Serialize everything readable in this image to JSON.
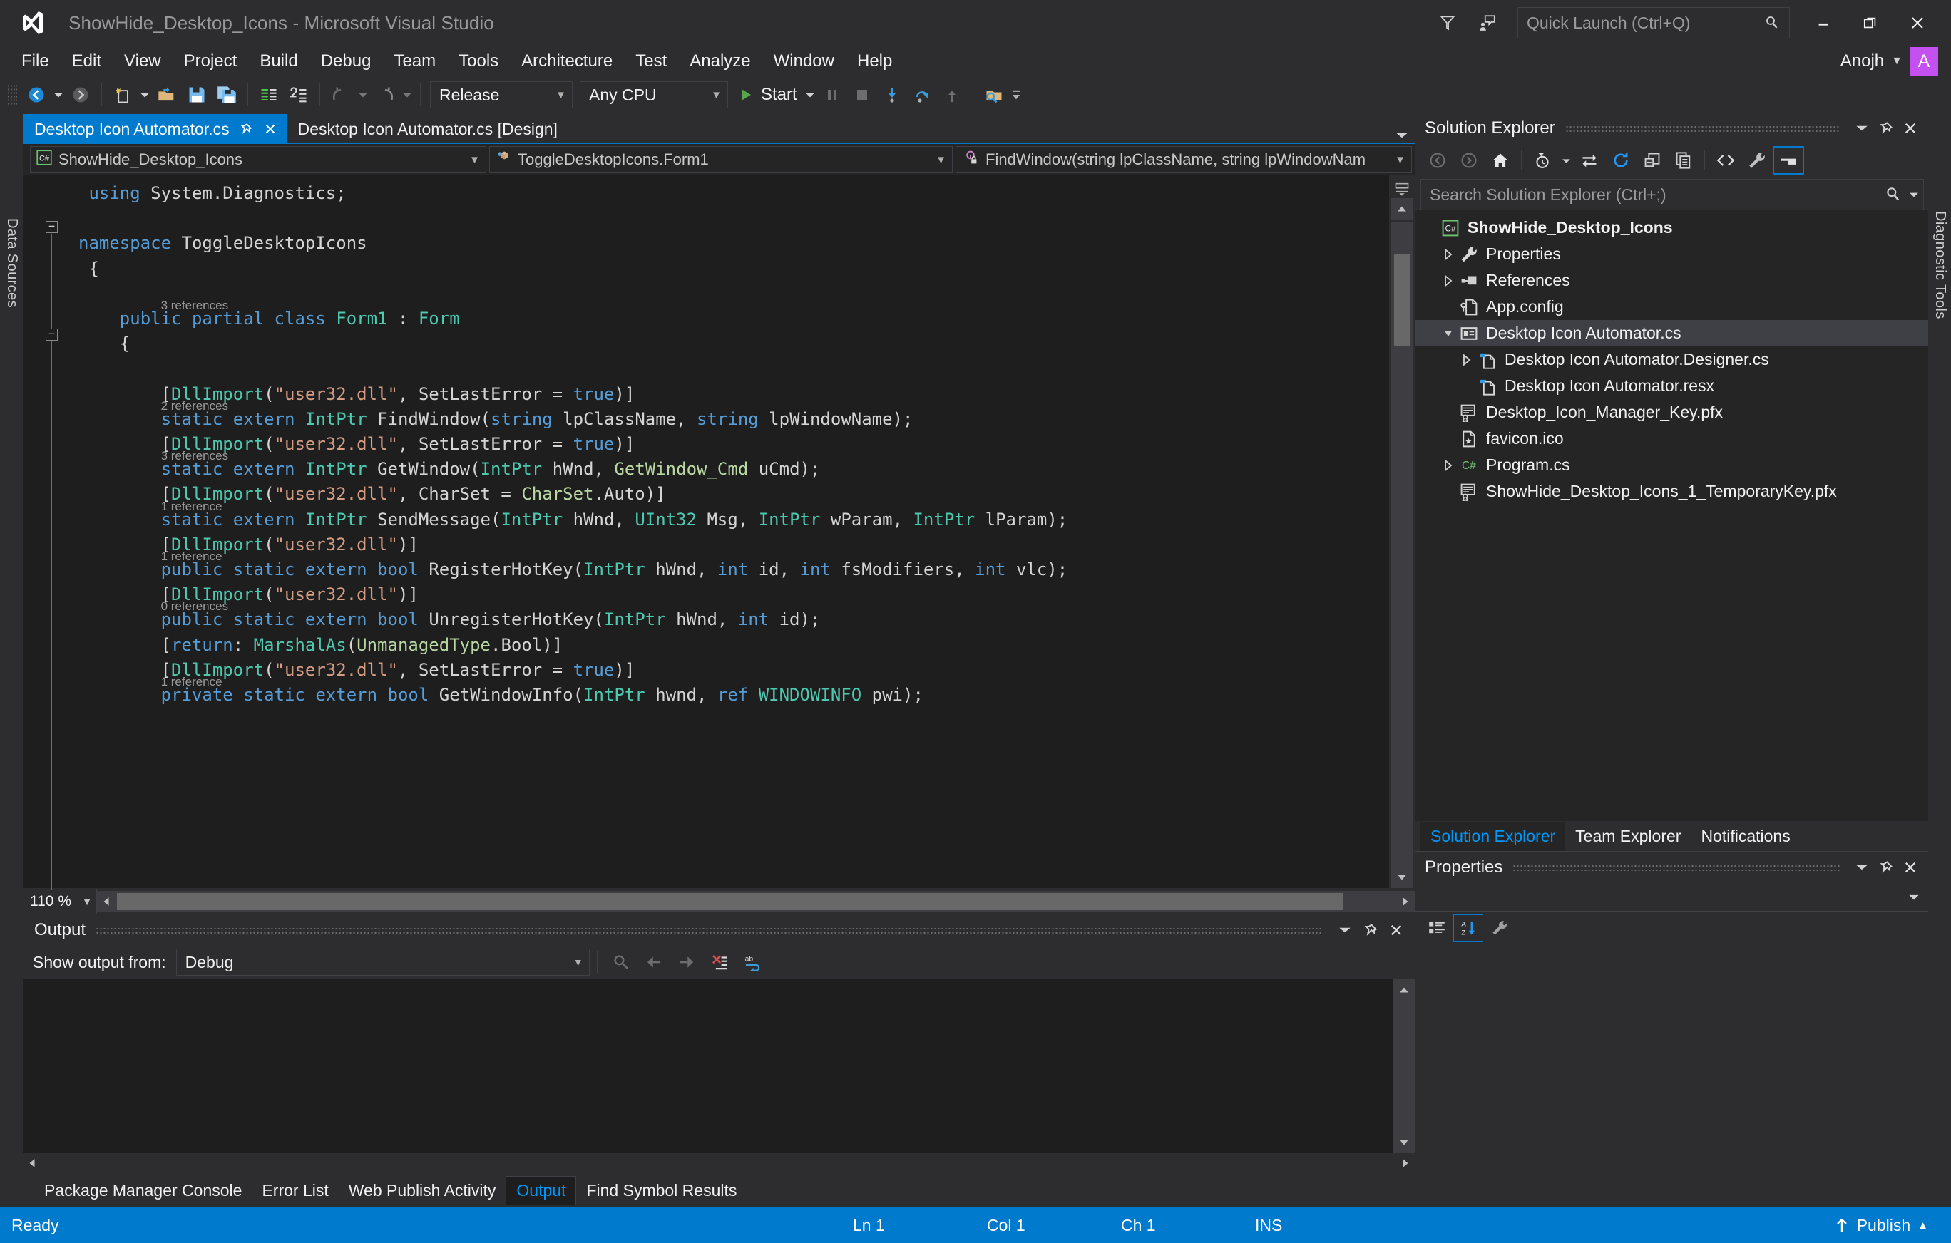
{
  "window": {
    "title": "ShowHide_Desktop_Icons - Microsoft Visual Studio",
    "logo_icon": "visual-studio-logo",
    "feedback_icon": "feedback-icon",
    "notify_icon": "send-feedback-icon",
    "minimize_icon": "minimize-icon",
    "restore_icon": "restore-icon",
    "close_icon": "close-icon"
  },
  "quick_launch": {
    "placeholder": "Quick Launch (Ctrl+Q)",
    "icon": "search-icon"
  },
  "account": {
    "name": "Anojh",
    "avatar_initial": "A",
    "avatar_color": "#c550f0"
  },
  "menu": {
    "items": [
      {
        "label": "File"
      },
      {
        "label": "Edit"
      },
      {
        "label": "View"
      },
      {
        "label": "Project"
      },
      {
        "label": "Build"
      },
      {
        "label": "Debug"
      },
      {
        "label": "Team"
      },
      {
        "label": "Tools"
      },
      {
        "label": "Architecture"
      },
      {
        "label": "Test"
      },
      {
        "label": "Analyze"
      },
      {
        "label": "Window"
      },
      {
        "label": "Help"
      }
    ]
  },
  "toolbar": {
    "back_icon": "navigate-back-icon",
    "forward_icon": "navigate-forward-icon",
    "new_item_icon": "new-item-icon",
    "open_file_icon": "open-file-icon",
    "save_icon": "save-icon",
    "save_all_icon": "save-all-icon",
    "comment_icon": "comment-lines-icon",
    "uncomment_icon": "uncomment-lines-icon",
    "undo_icon": "undo-icon",
    "redo_icon": "redo-icon",
    "configuration": "Release",
    "platform": "Any CPU",
    "start_label": "Start",
    "start_icon": "play-icon",
    "pause_icon": "pause-icon",
    "stop_icon": "stop-icon",
    "step_into_icon": "step-into-icon",
    "step_over_icon": "step-over-icon",
    "step_out_icon": "step-out-icon",
    "find_in_files_icon": "find-in-files-icon"
  },
  "left_strip": {
    "label": "Data Sources"
  },
  "right_strip": {
    "label": "Diagnostic Tools"
  },
  "editor": {
    "tabs": [
      {
        "label": "Desktop Icon Automator.cs",
        "active": true,
        "pin_icon": "pin-icon",
        "close_icon": "close-icon"
      },
      {
        "label": "Desktop Icon Automator.cs [Design]",
        "active": false
      }
    ],
    "tab_overflow_icon": "chevron-down-icon",
    "navbar": {
      "project": "ShowHide_Desktop_Icons",
      "project_icon": "csharp-project-icon",
      "type": "ToggleDesktopIcons.Form1",
      "type_icon": "class-icon",
      "member": "FindWindow(string lpClassName, string lpWindowNam",
      "member_icon": "method-private-icon",
      "caret_icon": "chevron-down-icon"
    },
    "zoom_level": "110 %",
    "split_icon": "split-view-icon",
    "code_lines": [
      {
        "indent": 1,
        "tokens": [
          {
            "t": "using ",
            "c": "kw"
          },
          {
            "t": "System.Diagnostics;",
            "c": "pl"
          }
        ]
      },
      {
        "indent": 0,
        "tokens": []
      },
      {
        "indent": 0,
        "tokens": [
          {
            "t": "namespace ",
            "c": "kw"
          },
          {
            "t": "ToggleDesktopIcons",
            "c": "pl"
          }
        ]
      },
      {
        "indent": 1,
        "tokens": [
          {
            "t": "{",
            "c": "pl"
          }
        ]
      },
      {
        "indent": 0,
        "tokens": []
      },
      {
        "indent": 4,
        "tokens": [
          {
            "t": "public ",
            "c": "kw"
          },
          {
            "t": "partial ",
            "c": "kw"
          },
          {
            "t": "class ",
            "c": "kw"
          },
          {
            "t": "Form1 ",
            "c": "ty"
          },
          {
            "t": ": ",
            "c": "pl"
          },
          {
            "t": "Form",
            "c": "ty"
          }
        ]
      },
      {
        "indent": 4,
        "tokens": [
          {
            "t": "{",
            "c": "pl"
          }
        ]
      },
      {
        "indent": 0,
        "tokens": []
      },
      {
        "indent": 8,
        "tokens": [
          {
            "t": "[",
            "c": "pl"
          },
          {
            "t": "DllImport",
            "c": "ty"
          },
          {
            "t": "(",
            "c": "pl"
          },
          {
            "t": "\"user32.dll\"",
            "c": "str"
          },
          {
            "t": ", SetLastError = ",
            "c": "pl"
          },
          {
            "t": "true",
            "c": "kw"
          },
          {
            "t": ")]",
            "c": "pl"
          }
        ]
      },
      {
        "indent": 8,
        "tokens": [
          {
            "t": "static ",
            "c": "kw"
          },
          {
            "t": "extern ",
            "c": "kw"
          },
          {
            "t": "IntPtr ",
            "c": "ty"
          },
          {
            "t": "FindWindow(",
            "c": "pl"
          },
          {
            "t": "string ",
            "c": "kw"
          },
          {
            "t": "lpClassName, ",
            "c": "pl"
          },
          {
            "t": "string ",
            "c": "kw"
          },
          {
            "t": "lpWindowName);",
            "c": "pl"
          }
        ]
      },
      {
        "indent": 8,
        "tokens": [
          {
            "t": "[",
            "c": "pl"
          },
          {
            "t": "DllImport",
            "c": "ty"
          },
          {
            "t": "(",
            "c": "pl"
          },
          {
            "t": "\"user32.dll\"",
            "c": "str"
          },
          {
            "t": ", SetLastError = ",
            "c": "pl"
          },
          {
            "t": "true",
            "c": "kw"
          },
          {
            "t": ")]",
            "c": "pl"
          }
        ]
      },
      {
        "indent": 8,
        "tokens": [
          {
            "t": "static ",
            "c": "kw"
          },
          {
            "t": "extern ",
            "c": "kw"
          },
          {
            "t": "IntPtr ",
            "c": "ty"
          },
          {
            "t": "GetWindow(",
            "c": "pl"
          },
          {
            "t": "IntPtr ",
            "c": "ty"
          },
          {
            "t": "hWnd, ",
            "c": "pl"
          },
          {
            "t": "GetWindow_Cmd ",
            "c": "en"
          },
          {
            "t": "uCmd);",
            "c": "pl"
          }
        ]
      },
      {
        "indent": 8,
        "tokens": [
          {
            "t": "[",
            "c": "pl"
          },
          {
            "t": "DllImport",
            "c": "ty"
          },
          {
            "t": "(",
            "c": "pl"
          },
          {
            "t": "\"user32.dll\"",
            "c": "str"
          },
          {
            "t": ", CharSet = ",
            "c": "pl"
          },
          {
            "t": "CharSet",
            "c": "en"
          },
          {
            "t": ".Auto)]",
            "c": "pl"
          }
        ]
      },
      {
        "indent": 8,
        "tokens": [
          {
            "t": "static ",
            "c": "kw"
          },
          {
            "t": "extern ",
            "c": "kw"
          },
          {
            "t": "IntPtr ",
            "c": "ty"
          },
          {
            "t": "SendMessage(",
            "c": "pl"
          },
          {
            "t": "IntPtr ",
            "c": "ty"
          },
          {
            "t": "hWnd, ",
            "c": "pl"
          },
          {
            "t": "UInt32 ",
            "c": "ty"
          },
          {
            "t": "Msg, ",
            "c": "pl"
          },
          {
            "t": "IntPtr ",
            "c": "ty"
          },
          {
            "t": "wParam, ",
            "c": "pl"
          },
          {
            "t": "IntPtr ",
            "c": "ty"
          },
          {
            "t": "lParam);",
            "c": "pl"
          }
        ]
      },
      {
        "indent": 8,
        "tokens": [
          {
            "t": "[",
            "c": "pl"
          },
          {
            "t": "DllImport",
            "c": "ty"
          },
          {
            "t": "(",
            "c": "pl"
          },
          {
            "t": "\"user32.dll\"",
            "c": "str"
          },
          {
            "t": ")]",
            "c": "pl"
          }
        ]
      },
      {
        "indent": 8,
        "tokens": [
          {
            "t": "public ",
            "c": "kw"
          },
          {
            "t": "static ",
            "c": "kw"
          },
          {
            "t": "extern ",
            "c": "kw"
          },
          {
            "t": "bool ",
            "c": "kw"
          },
          {
            "t": "RegisterHotKey(",
            "c": "pl"
          },
          {
            "t": "IntPtr ",
            "c": "ty"
          },
          {
            "t": "hWnd, ",
            "c": "pl"
          },
          {
            "t": "int ",
            "c": "kw"
          },
          {
            "t": "id, ",
            "c": "pl"
          },
          {
            "t": "int ",
            "c": "kw"
          },
          {
            "t": "fsModifiers, ",
            "c": "pl"
          },
          {
            "t": "int ",
            "c": "kw"
          },
          {
            "t": "vlc);",
            "c": "pl"
          }
        ]
      },
      {
        "indent": 8,
        "tokens": [
          {
            "t": "[",
            "c": "pl"
          },
          {
            "t": "DllImport",
            "c": "ty"
          },
          {
            "t": "(",
            "c": "pl"
          },
          {
            "t": "\"user32.dll\"",
            "c": "str"
          },
          {
            "t": ")]",
            "c": "pl"
          }
        ]
      },
      {
        "indent": 8,
        "tokens": [
          {
            "t": "public ",
            "c": "kw"
          },
          {
            "t": "static ",
            "c": "kw"
          },
          {
            "t": "extern ",
            "c": "kw"
          },
          {
            "t": "bool ",
            "c": "kw"
          },
          {
            "t": "UnregisterHotKey(",
            "c": "pl"
          },
          {
            "t": "IntPtr ",
            "c": "ty"
          },
          {
            "t": "hWnd, ",
            "c": "pl"
          },
          {
            "t": "int ",
            "c": "kw"
          },
          {
            "t": "id);",
            "c": "pl"
          }
        ]
      },
      {
        "indent": 8,
        "tokens": [
          {
            "t": "[",
            "c": "pl"
          },
          {
            "t": "return",
            "c": "kw"
          },
          {
            "t": ": ",
            "c": "pl"
          },
          {
            "t": "MarshalAs",
            "c": "ty"
          },
          {
            "t": "(",
            "c": "pl"
          },
          {
            "t": "UnmanagedType",
            "c": "en"
          },
          {
            "t": ".Bool)]",
            "c": "pl"
          }
        ]
      },
      {
        "indent": 8,
        "tokens": [
          {
            "t": "[",
            "c": "pl"
          },
          {
            "t": "DllImport",
            "c": "ty"
          },
          {
            "t": "(",
            "c": "pl"
          },
          {
            "t": "\"user32.dll\"",
            "c": "str"
          },
          {
            "t": ", SetLastError = ",
            "c": "pl"
          },
          {
            "t": "true",
            "c": "kw"
          },
          {
            "t": ")]",
            "c": "pl"
          }
        ]
      },
      {
        "indent": 8,
        "tokens": [
          {
            "t": "private ",
            "c": "kw"
          },
          {
            "t": "static ",
            "c": "kw"
          },
          {
            "t": "extern ",
            "c": "kw"
          },
          {
            "t": "bool ",
            "c": "kw"
          },
          {
            "t": "GetWindowInfo(",
            "c": "pl"
          },
          {
            "t": "IntPtr ",
            "c": "ty"
          },
          {
            "t": "hwnd, ",
            "c": "pl"
          },
          {
            "t": "ref ",
            "c": "kw"
          },
          {
            "t": "WINDOWINFO ",
            "c": "ty"
          },
          {
            "t": "pwi);",
            "c": "pl"
          }
        ]
      }
    ],
    "codelens": [
      {
        "line": 5,
        "text": "3 references"
      },
      {
        "line": 9,
        "text": "2 references"
      },
      {
        "line": 11,
        "text": "3 references"
      },
      {
        "line": 13,
        "text": "1 reference"
      },
      {
        "line": 15,
        "text": "1 reference"
      },
      {
        "line": 17,
        "text": "0 references"
      },
      {
        "line": 20,
        "text": "1 reference"
      }
    ]
  },
  "output": {
    "title": "Output",
    "show_output_from_label": "Show output from:",
    "source": "Debug",
    "content": "",
    "dropdown_icon": "chevron-down-icon",
    "pin_icon": "pin-icon",
    "close_icon": "close-icon",
    "find_message_icon": "find-message-icon",
    "go_to_previous_icon": "go-to-previous-message-icon",
    "go_to_next_icon": "go-to-next-message-icon",
    "clear_all_icon": "clear-all-icon",
    "toggle_wordwrap_icon": "toggle-word-wrap-icon"
  },
  "dock_tabs": [
    {
      "label": "Package Manager Console",
      "active": false
    },
    {
      "label": "Error List",
      "active": false
    },
    {
      "label": "Web Publish Activity",
      "active": false
    },
    {
      "label": "Output",
      "active": true
    },
    {
      "label": "Find Symbol Results",
      "active": false
    }
  ],
  "solution_explorer": {
    "title": "Solution Explorer",
    "search_placeholder": "Search Solution Explorer (Ctrl+;)",
    "search_icon": "search-icon",
    "toolbar": {
      "back_icon": "navigate-back-icon",
      "forward_icon": "navigate-forward-icon",
      "home_icon": "home-icon",
      "pending_changes_icon": "pending-changes-filter-icon",
      "sync_icon": "sync-with-active-document-icon",
      "refresh_icon": "refresh-icon",
      "collapse_all_icon": "collapse-all-icon",
      "show_all_files_icon": "show-all-files-icon",
      "view_code_icon": "view-code-icon",
      "properties_icon": "properties-wrench-icon",
      "preview_icon": "preview-selected-items-icon"
    },
    "tree": [
      {
        "label": "ShowHide_Desktop_Icons",
        "level": 0,
        "icon": "csharp-project-icon",
        "expander": "none",
        "bold": true,
        "selected": false
      },
      {
        "label": "Properties",
        "level": 1,
        "icon": "properties-wrench-icon",
        "expander": "collapsed",
        "bold": false,
        "selected": false
      },
      {
        "label": "References",
        "level": 1,
        "icon": "references-icon",
        "expander": "collapsed",
        "bold": false,
        "selected": false
      },
      {
        "label": "App.config",
        "level": 1,
        "icon": "config-file-icon",
        "expander": "none",
        "bold": false,
        "selected": false
      },
      {
        "label": "Desktop Icon Automator.cs",
        "level": 1,
        "icon": "form-icon",
        "expander": "expanded",
        "bold": false,
        "selected": true
      },
      {
        "label": "Desktop Icon Automator.Designer.cs",
        "level": 2,
        "icon": "designer-file-icon",
        "expander": "collapsed",
        "bold": false,
        "selected": false
      },
      {
        "label": "Desktop Icon Automator.resx",
        "level": 2,
        "icon": "resx-file-icon",
        "expander": "none",
        "bold": false,
        "selected": false
      },
      {
        "label": "Desktop_Icon_Manager_Key.pfx",
        "level": 1,
        "icon": "certificate-icon",
        "expander": "none",
        "bold": false,
        "selected": false
      },
      {
        "label": "favicon.ico",
        "level": 1,
        "icon": "image-file-icon",
        "expander": "none",
        "bold": false,
        "selected": false
      },
      {
        "label": "Program.cs",
        "level": 1,
        "icon": "csharp-file-icon",
        "expander": "collapsed",
        "bold": false,
        "selected": false
      },
      {
        "label": "ShowHide_Desktop_Icons_1_TemporaryKey.pfx",
        "level": 1,
        "icon": "certificate-icon",
        "expander": "none",
        "bold": false,
        "selected": false
      }
    ],
    "tabs": [
      {
        "label": "Solution Explorer",
        "active": true
      },
      {
        "label": "Team Explorer",
        "active": false
      },
      {
        "label": "Notifications",
        "active": false
      }
    ]
  },
  "properties": {
    "title": "Properties",
    "dropdown_icon": "chevron-down-icon",
    "pin_icon": "pin-icon",
    "close_icon": "close-icon",
    "categorized_icon": "categorized-view-icon",
    "alphabetical_icon": "alphabetical-sort-icon",
    "property_pages_icon": "property-pages-wrench-icon"
  },
  "status_bar": {
    "state": "Ready",
    "line": "Ln 1",
    "column": "Col 1",
    "character": "Ch 1",
    "insert_mode": "INS",
    "publish_label": "Publish",
    "publish_icon": "publish-arrow-icon",
    "publish_caret_icon": "chevron-up-icon",
    "background": "#007acc"
  }
}
